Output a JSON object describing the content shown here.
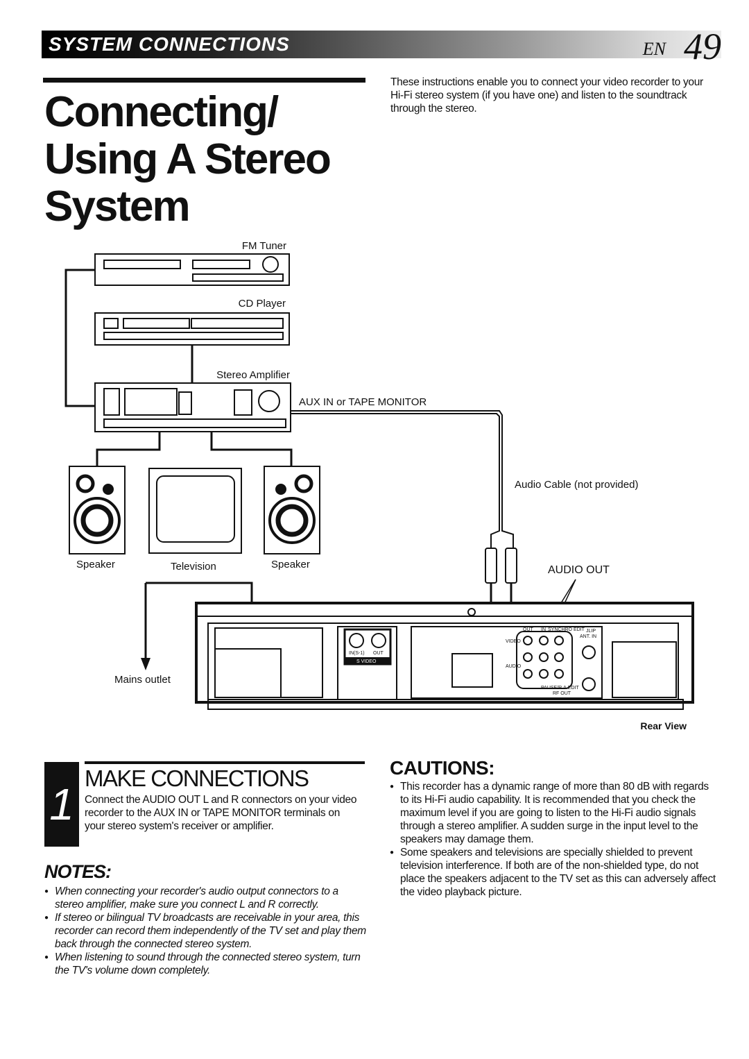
{
  "header": {
    "section": "SYSTEM CONNECTIONS",
    "lang": "EN",
    "page": "49"
  },
  "title": {
    "line1": "Connecting/",
    "line2": "Using A Stereo",
    "line3": "System"
  },
  "intro": "These instructions enable you to connect your video recorder to your Hi-Fi stereo system (if you have one) and listen to the soundtrack through the stereo.",
  "diagram": {
    "fm_tuner": "FM Tuner",
    "cd_player": "CD Player",
    "stereo_amplifier": "Stereo Amplifier",
    "aux_in": "AUX IN or TAPE MONITOR",
    "audio_cable": "Audio Cable (not provided)",
    "speaker_left": "Speaker",
    "television": "Television",
    "speaker_right": "Speaker",
    "audio_out": "AUDIO OUT",
    "mains_outlet": "Mains outlet",
    "rear_view": "Rear View",
    "panel": {
      "s_in": "IN(S-1)",
      "s_out": "OUT",
      "s_video": "S  VIDEO",
      "out": "OUT",
      "in": "IN",
      "synchro_edit": "SYNCHRO EDIT",
      "jlip": "JLIP",
      "ant_in": "ANT. IN",
      "video": "VIDEO",
      "audio": "AUDIO",
      "pause": "PAUSE/R.A.EDIT",
      "rf_out": "RF OUT"
    }
  },
  "step": {
    "number": "1",
    "title": "MAKE CONNECTIONS",
    "text": "Connect the AUDIO OUT L and R connectors on your video recorder to the AUX IN or TAPE MONITOR terminals on your stereo system's receiver or amplifier."
  },
  "notes": {
    "title": "NOTES:",
    "items": [
      "When connecting your recorder's audio output connectors to a stereo amplifier, make sure you connect L and R correctly.",
      "If stereo or bilingual TV broadcasts are receivable in your area, this recorder can record them independently of the TV set and play them back through the connected stereo system.",
      "When listening to sound through the connected stereo system, turn the TV's volume down completely."
    ]
  },
  "cautions": {
    "title": "CAUTIONS:",
    "items": [
      "This recorder has a dynamic range of more than 80 dB with regards to its Hi-Fi audio capability. It is recommended that you check the maximum level if you are going to listen to the Hi-Fi audio signals through a stereo amplifier. A sudden surge in the input level to the speakers may damage them.",
      "Some speakers and televisions are specially shielded to prevent television interference. If both are of the non-shielded type, do not place the speakers adjacent to the TV set as this can adversely affect the video playback picture."
    ]
  }
}
